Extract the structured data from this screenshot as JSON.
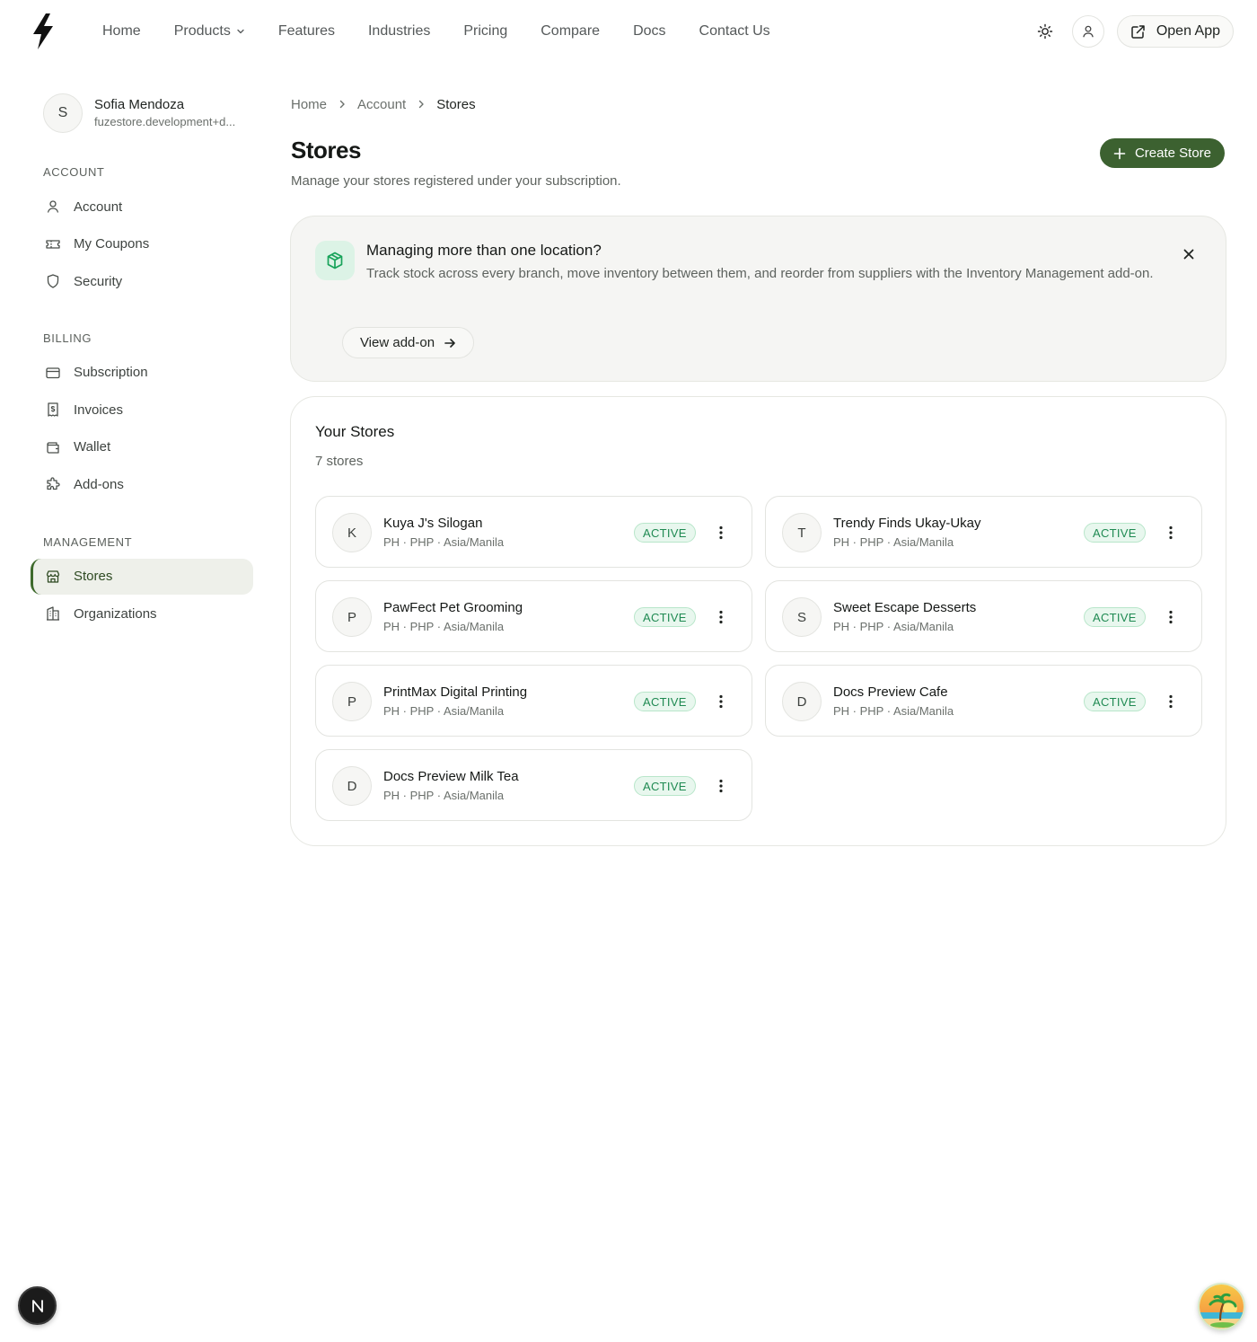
{
  "nav": {
    "links": [
      {
        "label": "Home"
      },
      {
        "label": "Products"
      },
      {
        "label": "Features"
      },
      {
        "label": "Industries"
      },
      {
        "label": "Pricing"
      },
      {
        "label": "Compare"
      },
      {
        "label": "Docs"
      },
      {
        "label": "Contact Us"
      }
    ],
    "open_app_label": "Open App",
    "icons": {
      "logo": "bolt-logo",
      "theme": "sun-icon",
      "user": "user-icon",
      "open_app": "external-link-icon"
    }
  },
  "sidebar": {
    "profile": {
      "initial": "S",
      "name": "Sofia Mendoza",
      "email": "fuzestore.development+d..."
    },
    "sections": [
      {
        "title": "ACCOUNT",
        "items": [
          {
            "label": "Account",
            "icon": "user-icon"
          },
          {
            "label": "My Coupons",
            "icon": "ticket-icon"
          },
          {
            "label": "Security",
            "icon": "shield-icon"
          }
        ]
      },
      {
        "title": "BILLING",
        "items": [
          {
            "label": "Subscription",
            "icon": "credit-card-icon"
          },
          {
            "label": "Invoices",
            "icon": "receipt-icon"
          },
          {
            "label": "Wallet",
            "icon": "wallet-icon"
          },
          {
            "label": "Add-ons",
            "icon": "puzzle-icon"
          }
        ]
      },
      {
        "title": "MANAGEMENT",
        "items": [
          {
            "label": "Stores",
            "icon": "store-icon",
            "active": true
          },
          {
            "label": "Organizations",
            "icon": "building-icon"
          }
        ]
      }
    ]
  },
  "breadcrumb": [
    "Home",
    "Account",
    "Stores"
  ],
  "page": {
    "title": "Stores",
    "subtitle": "Manage your stores registered under your subscription.",
    "create_label": "Create Store"
  },
  "promo": {
    "title": "Managing more than one location?",
    "text": "Track stock across every branch, move inventory between them, and reorder from suppliers with the Inventory Management add-on.",
    "button_label": "View add-on"
  },
  "stores": {
    "title": "Your Stores",
    "count_label": "7 stores",
    "items": [
      {
        "initial": "K",
        "name": "Kuya J's Silogan",
        "meta": "PH · PHP · Asia/Manila",
        "status": "ACTIVE"
      },
      {
        "initial": "T",
        "name": "Trendy Finds Ukay-Ukay",
        "meta": "PH · PHP · Asia/Manila",
        "status": "ACTIVE"
      },
      {
        "initial": "P",
        "name": "PawFect Pet Grooming",
        "meta": "PH · PHP · Asia/Manila",
        "status": "ACTIVE"
      },
      {
        "initial": "S",
        "name": "Sweet Escape Desserts",
        "meta": "PH · PHP · Asia/Manila",
        "status": "ACTIVE"
      },
      {
        "initial": "P",
        "name": "PrintMax Digital Printing",
        "meta": "PH · PHP · Asia/Manila",
        "status": "ACTIVE"
      },
      {
        "initial": "D",
        "name": "Docs Preview Cafe",
        "meta": "PH · PHP · Asia/Manila",
        "status": "ACTIVE"
      },
      {
        "initial": "D",
        "name": "Docs Preview Milk Tea",
        "meta": "PH · PHP · Asia/Manila",
        "status": "ACTIVE"
      }
    ]
  },
  "floating": {
    "dev_badge": "N"
  },
  "colors": {
    "accent": "#3c6130",
    "active_badge": "#1f8a52",
    "promo_bg": "#f5f5f3"
  }
}
